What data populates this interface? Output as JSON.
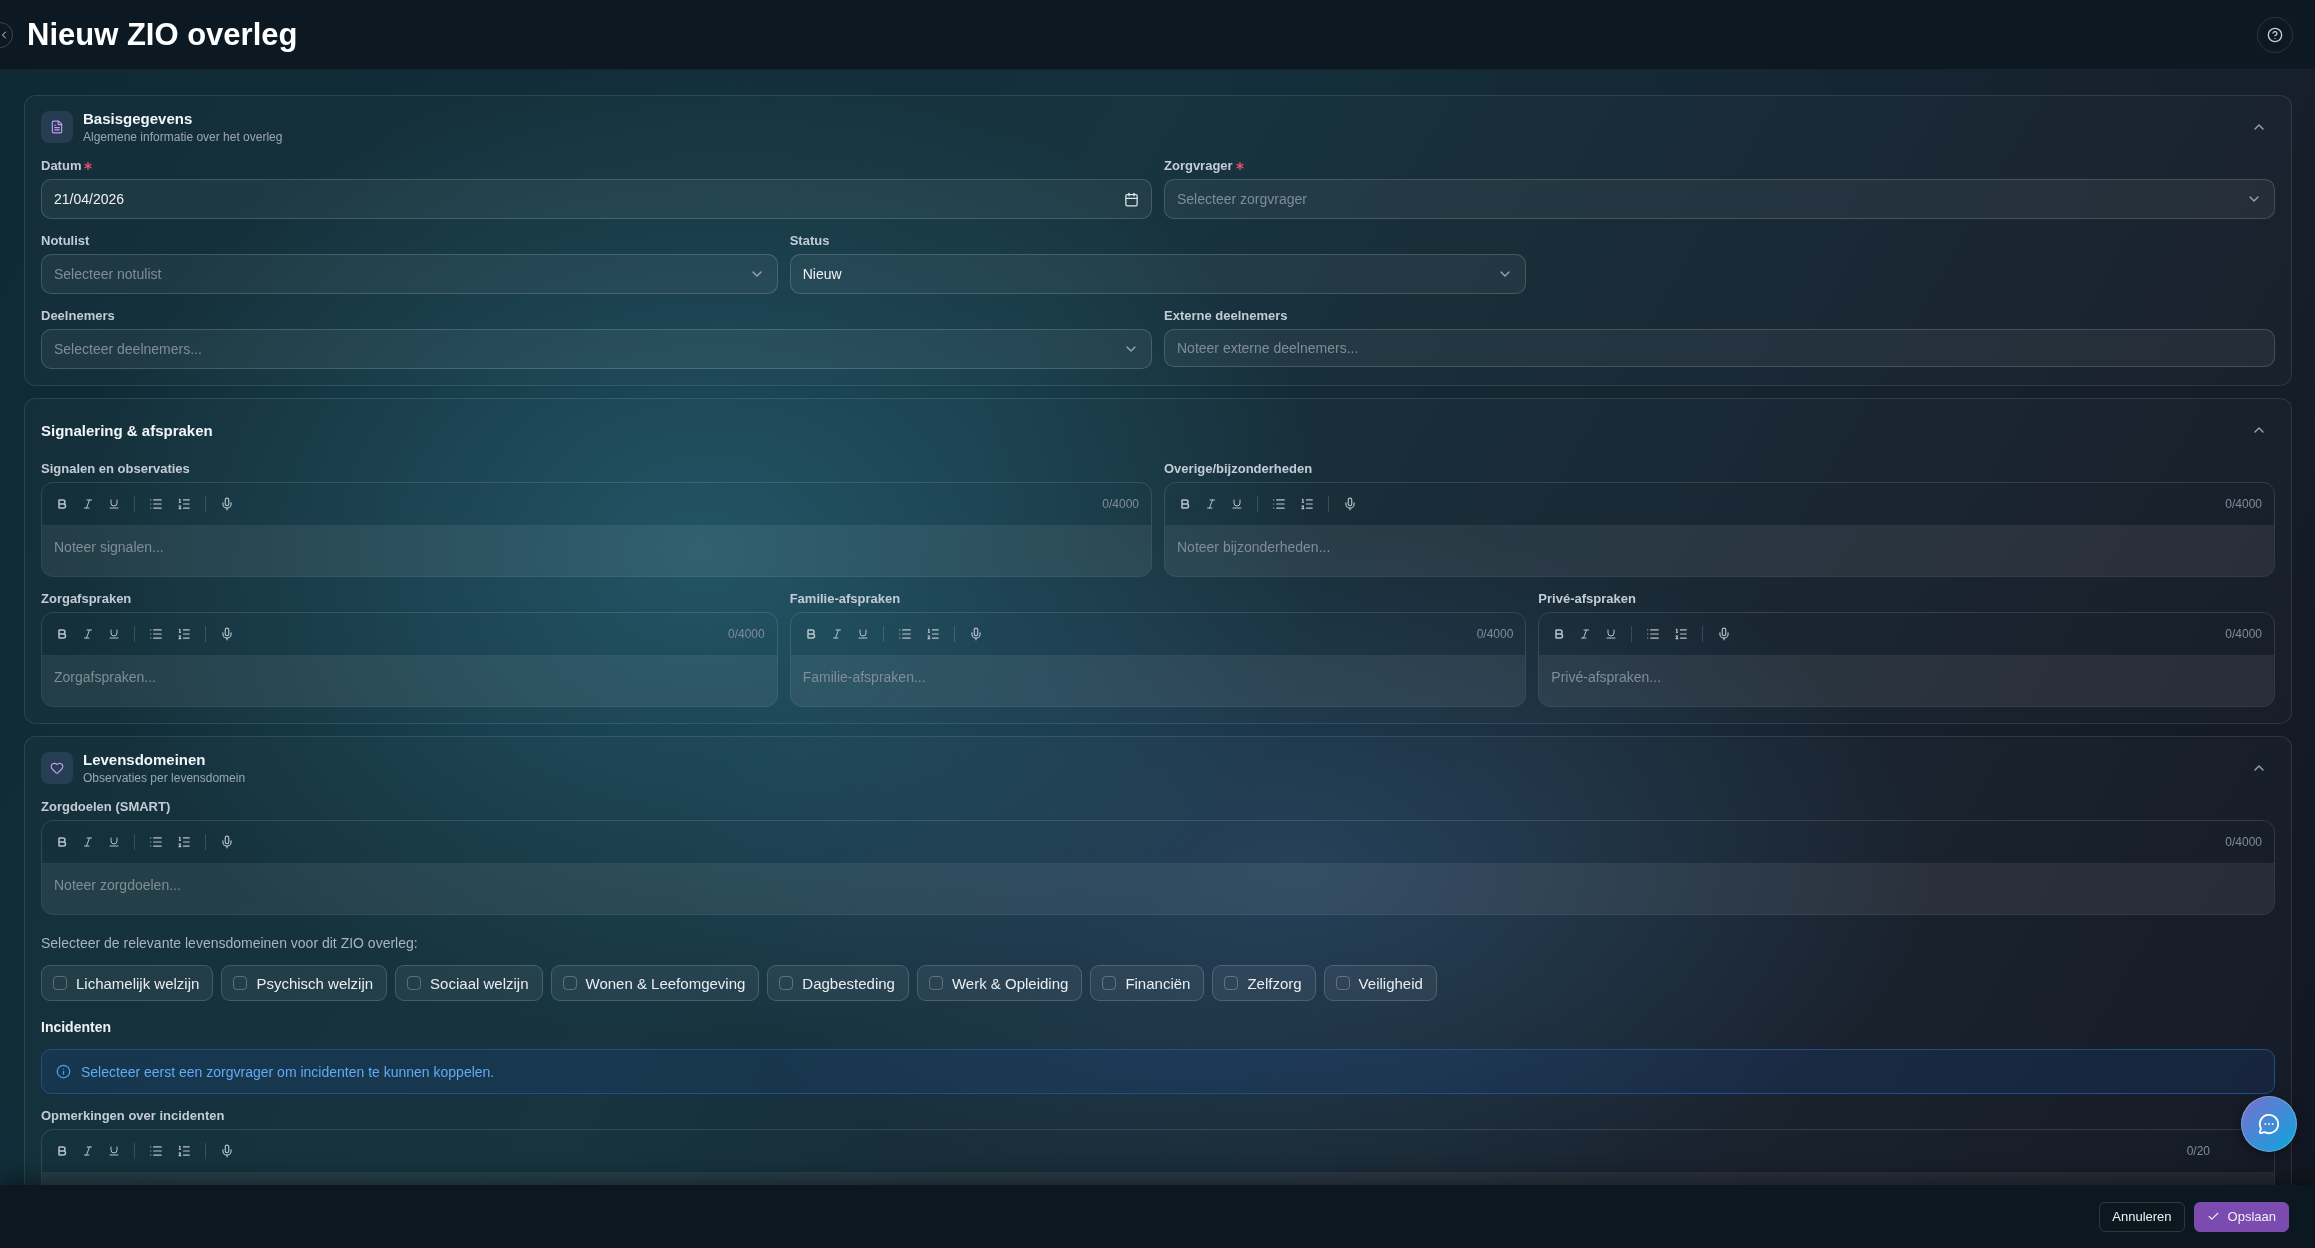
{
  "page": {
    "title": "Nieuw ZIO overleg"
  },
  "sections": [
    {
      "title": "Basisgegevens",
      "subtitle": "Algemene informatie over het overleg",
      "expanded": true,
      "blocks": [
        {
          "kind": "fields",
          "fields": [
            {
              "kind": "date",
              "label": "Datum",
              "required": true,
              "value": "21/04/2026"
            },
            {
              "kind": "select",
              "label": "Zorgvrager",
              "required": true,
              "placeholder": "Selecteer zorgvrager"
            }
          ]
        },
        {
          "kind": "fields",
          "fields": [
            {
              "kind": "select",
              "label": "Notulist",
              "placeholder": "Selecteer notulist"
            },
            {
              "kind": "select",
              "label": "Status",
              "value": "Nieuw"
            }
          ]
        },
        {
          "kind": "fields",
          "fields": [
            {
              "kind": "select",
              "label": "Deelnemers",
              "placeholder": "Selecteer deelnemers..."
            },
            {
              "kind": "text",
              "label": "Externe deelnemers",
              "placeholder": "Noteer externe deelnemers..."
            }
          ]
        }
      ]
    },
    {
      "title": "Signalering & afspraken",
      "expanded": true,
      "blocks": [
        {
          "kind": "editors",
          "editors": [
            {
              "label": "Signalen en observaties",
              "placeholder": "Noteer signalen...",
              "counter": "0/4000"
            },
            {
              "label": "Overige/bijzonderheden",
              "placeholder": "Noteer bijzonderheden...",
              "counter": "0/4000"
            }
          ]
        },
        {
          "kind": "editors",
          "editors": [
            {
              "label": "Zorgafspraken",
              "placeholder": "Zorgafspraken...",
              "counter": "0/4000"
            },
            {
              "label": "Familie-afspraken",
              "placeholder": "Familie-afspraken...",
              "counter": "0/4000"
            },
            {
              "label": "Privé-afspraken",
              "placeholder": "Privé-afspraken...",
              "counter": "0/4000"
            }
          ]
        }
      ]
    },
    {
      "title": "Levensdomeinen",
      "subtitle": "Observaties per levensdomein",
      "expanded": true,
      "blocks": [
        {
          "kind": "editors",
          "editors": [
            {
              "label": "Zorgdoelen (SMART)",
              "placeholder": "Noteer zorgdoelen...",
              "counter": "0/4000"
            }
          ]
        },
        {
          "kind": "prompt",
          "text": "Selecteer de relevante levensdomeinen voor dit ZIO overleg:"
        },
        {
          "kind": "chips",
          "items": [
            {
              "label": "Lichamelijk welzijn",
              "checked": false
            },
            {
              "label": "Psychisch welzijn",
              "checked": false
            },
            {
              "label": "Sociaal welzijn",
              "checked": false
            },
            {
              "label": "Wonen & Leefomgeving",
              "checked": false
            },
            {
              "label": "Dagbesteding",
              "checked": false
            },
            {
              "label": "Werk & Opleiding",
              "checked": false
            },
            {
              "label": "Financiën",
              "checked": false
            },
            {
              "label": "Zelfzorg",
              "checked": false
            },
            {
              "label": "Veiligheid",
              "checked": false
            }
          ]
        },
        {
          "kind": "heading",
          "text": "Incidenten"
        },
        {
          "kind": "notice",
          "text": "Selecteer eerst een zorgvrager om incidenten te kunnen koppelen."
        },
        {
          "kind": "editors",
          "editors": [
            {
              "label": "Opmerkingen over incidenten",
              "counter": "0/20"
            }
          ]
        }
      ]
    }
  ],
  "footer": {
    "buttons": [
      {
        "kind": "secondary",
        "label": "Annuleren"
      },
      {
        "kind": "primary",
        "label": "Opslaan"
      }
    ]
  }
}
